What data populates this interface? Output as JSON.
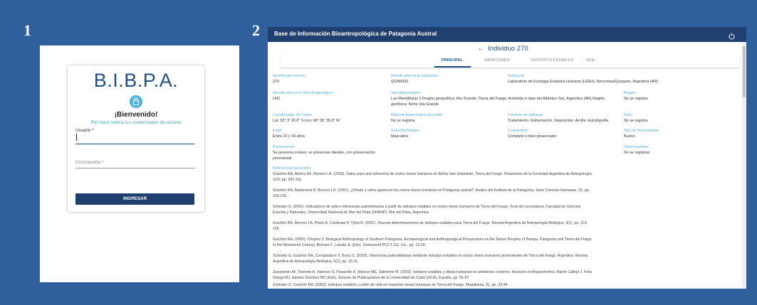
{
  "panels": {
    "first": "1",
    "second": "2"
  },
  "login": {
    "logo": "B.I.B.P.A.",
    "icon": "lock-icon",
    "welcome": "¡Bienvenido!",
    "subtitle": "Por favor indica tus credenciales de acceso",
    "user_label": "Usuario *",
    "user_value": "",
    "password_label": "Contraseña *",
    "password_value": "",
    "button": "INGRESAR"
  },
  "app": {
    "title": "Base de Información Bioantropológica de Patagonia Austral",
    "power_icon": "power-icon",
    "back_icon": "arrow-left-icon",
    "individual": "Individuo 270",
    "tabs": [
      "PRINCIPAL",
      "DATACIONES",
      "ISOTOPOS ESTABLES",
      "ADN"
    ],
    "active_tab": 0
  },
  "fields": {
    "id_interno": {
      "label": "Identificador Interno",
      "value": "270"
    },
    "id_institucion": {
      "label": "Identificador en la Institución",
      "value": "QGN0002"
    },
    "institucion": {
      "label": "Institución",
      "value": "Laboratorio de Ecología Evolutiva Humana (LEEH), Necochea/Quequén, Argentina (AR)"
    },
    "id_sitio": {
      "label": "Identificador en el Sitio Arqueológico",
      "value": "LM1"
    },
    "sitio": {
      "label": "Sitio Arqueológico",
      "value": "Las Mandíbulas 1 Región geopolítica: Río Grande, Tierra del Fuego, Antártida e Islas del Atlántico Sur, Argentina (AR) Región geofísica: Norte Isla Grande"
    },
    "region": {
      "label": "Región",
      "value": "No se registra"
    },
    "coordenadas": {
      "label": "Coordenadas de Origen",
      "value": "Lat: 53° 3' 28.0\" S Lon: 68° 30' 35.0\" W"
    },
    "material": {
      "label": "Material Arqueológico Asociado",
      "value": "No se registra"
    },
    "contexto": {
      "label": "Contexto de Hallazgo",
      "value": "Tratamiento: Inuhumación. Deposición: Arcilla. Estratigrafía"
    },
    "etnia": {
      "label": "Etnia",
      "value": "No se registra"
    },
    "edad": {
      "label": "Edad",
      "value": "Entre 20 y 34 años"
    },
    "sexo": {
      "label": "Sexo Morfológico",
      "value": "Masculino"
    },
    "completitud": {
      "label": "Completitud",
      "value": "Completo o bien preservado"
    },
    "tipo_preservacion": {
      "label": "Tipo de Preservación",
      "value": "Bueno"
    },
    "preservacion": {
      "label": "Preservación",
      "value": "Se preserva cráneo, se preservan dientes, con preservación poscraneal"
    },
    "observaciones": {
      "label": "Observaciones",
      "value": "No se registran"
    }
  },
  "references": {
    "label": "Referencias Generales",
    "items": [
      "Guichón RA, Muñoz AS, Borrero LA. (2000). Datos para una tafonomía de restos óseos humanos en Bahía San Sebastián, Tierra del Fuego. Relaciones de la Sociedad Argentina de Antropología, XXV, pp. 297-311.",
      "Guichón RA, Barberena R, Borrero LA. (2001). ¿Dónde y cómo aparecen los restos óseos humanos en Patagonia austral?. Anales del Instituto de la Patagonia, Serie Ciencias Humanas, 29, pp. 103-118.",
      "Schinder G. (2001). Indicadores de vida e inferencias paleodietarias a partir de isótopos estables en restos óseos humanos de Tierra del Fuego. Tesis de Licenciatura. Facultad de Ciencias Exactas y Naturales, Universidad Nacional de Mar del Plata (UNMdP), Mar del Plata, Argentina.",
      "Guichón RA, Borrero LA, Prieto A, Cárdenas P, Tykot R. (2001). Nuevas determinaciones de isótopos estables para Tierra del Fuego. Revista Argentina de Antropología Biológica, 3(1), pp. 113-126.",
      "Guichón RA. (2002). Chapter 2: Biological Anthropology of Southern Patagonia. Archaeological and Anthropological Perspectives on the Native Peoples of Pampa, Patagonia and Tierra del Fuego to the Nineteenth Century. Briones C, Lanata JL (Eds). Greenword PCCT, EE. UU., pp. 13-29.",
      "Schinder G, Guichón RA, Comparatore V, Burry S. (2003). Inferencias paleodietarias mediante isótopos estables en restos óseos humanos provenientes de Tierra del Fuego, Argentina. Revista Argentina de Antropología Biológica, 5(2), pp. 15-31.",
      "Zangrando AF, Tessone A, Valencio S, Panarello H, Mansur ME, Salemme M. (2003). Isótopos estables y dietas humanas en ambientes costeros. Avances en Arqueometría. Martín Callejo J, Feliu Ortega MJ, Edreira Sánchez MC (Eds). Servicio de Publicaciones de la Universidad de Cádiz (UCA), España, pp. 91-97.",
      "Schinder G, Guichón RA. (2003). Isótopos estables y estilo de vida en muestras óseas humanas de Tierra del Fuego. Magallania, 31, pp. 33-44."
    ]
  }
}
